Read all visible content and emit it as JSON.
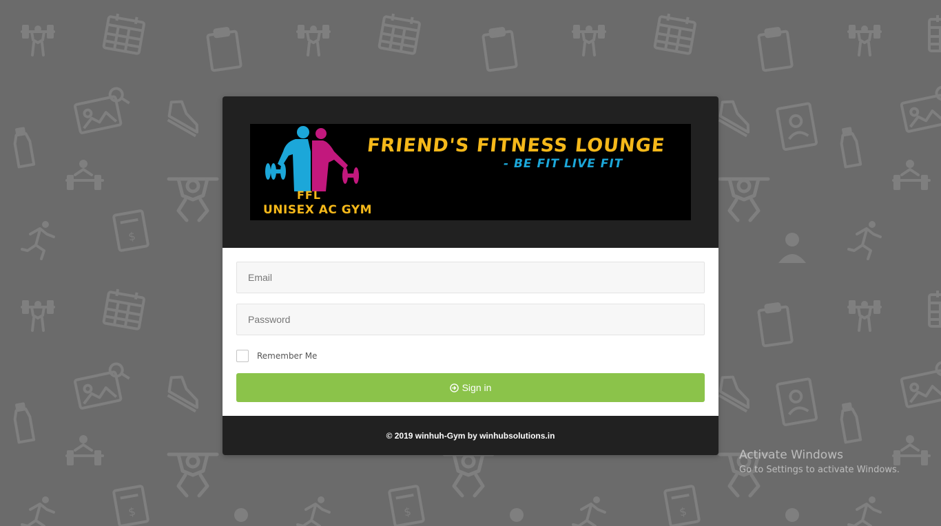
{
  "background": {
    "color": "#6b6b6b",
    "pattern_icons": [
      "weightlifter-icon",
      "calendar-icon",
      "clipboard-icon",
      "id-card-icon",
      "magnifier-icon",
      "sneaker-icon",
      "bottle-icon",
      "bench-press-icon",
      "squat-icon",
      "receipt-icon",
      "runner-icon",
      "profile-book-icon",
      "user-icon"
    ]
  },
  "banner": {
    "logo_text": "FFL",
    "subtitle": "UNISEX AC GYM",
    "title": "FRIEND'S FITNESS LOUNGE",
    "tagline": "- BE FIT LIVE FIT",
    "colors": {
      "gold": "#f5b81a",
      "cyan": "#1ca7d9",
      "magenta": "#c2187d"
    }
  },
  "form": {
    "email_placeholder": "Email",
    "password_placeholder": "Password",
    "remember_label": "Remember Me",
    "signin_label": "Sign in",
    "signin_icon": "sign-in-icon",
    "button_color": "#8bc34a"
  },
  "footer": {
    "copyright": "© 2019 winhuh-Gym by winhubsolutions.in"
  },
  "watermark": {
    "title": "Activate Windows",
    "subtitle": "Go to Settings to activate Windows."
  }
}
